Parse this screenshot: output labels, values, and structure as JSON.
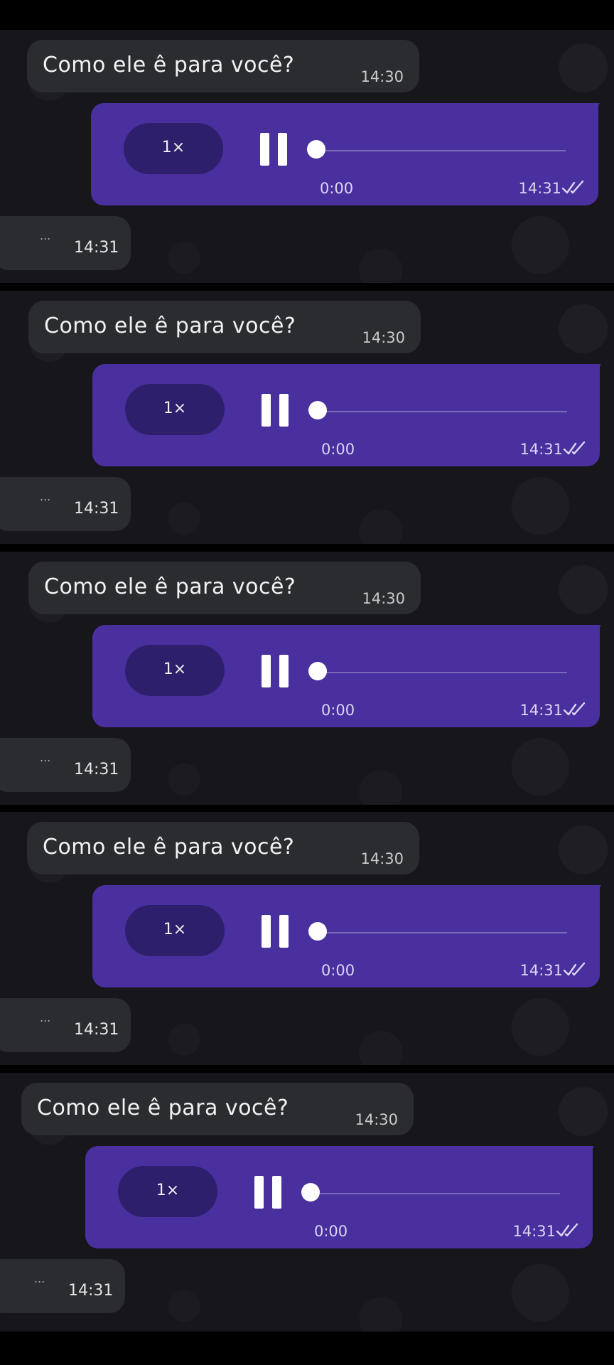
{
  "colors": {
    "incoming_bubble": "#2a2c30",
    "outgoing_bubble": "#4a2f9e",
    "speed_pill": "#2d1f6b",
    "background": "#16161b"
  },
  "repeated_frames": [
    {
      "incoming_message": {
        "text": "Como ele ê para você?",
        "time": "14:30"
      },
      "voice_message": {
        "speed": "1×",
        "duration": "0:00",
        "time": "14:31",
        "status_icon": "double-check-icon",
        "progress": 0.0
      },
      "reply_message": {
        "text": "...",
        "time": "14:31"
      }
    },
    {
      "incoming_message": {
        "text": "Como ele ê para você?",
        "time": "14:30"
      },
      "voice_message": {
        "speed": "1×",
        "duration": "0:00",
        "time": "14:31",
        "status_icon": "double-check-icon",
        "progress": 0.0
      },
      "reply_message": {
        "text": "...",
        "time": "14:31"
      }
    },
    {
      "incoming_message": {
        "text": "Como ele ê para você?",
        "time": "14:30"
      },
      "voice_message": {
        "speed": "1×",
        "duration": "0:00",
        "time": "14:31",
        "status_icon": "double-check-icon",
        "progress": 0.0
      },
      "reply_message": {
        "text": "...",
        "time": "14:31"
      }
    },
    {
      "incoming_message": {
        "text": "Como ele ê para você?",
        "time": "14:30"
      },
      "voice_message": {
        "speed": "1×",
        "duration": "0:00",
        "time": "14:31",
        "status_icon": "double-check-icon",
        "progress": 0.0
      },
      "reply_message": {
        "text": "...",
        "time": "14:31"
      }
    },
    {
      "incoming_message": {
        "text": "Como ele ê para você?",
        "time": "14:30"
      },
      "voice_message": {
        "speed": "1×",
        "duration": "0:00",
        "time": "14:31",
        "status_icon": "double-check-icon",
        "progress": 0.0
      },
      "reply_message": {
        "text": "...",
        "time": "14:31"
      }
    }
  ]
}
